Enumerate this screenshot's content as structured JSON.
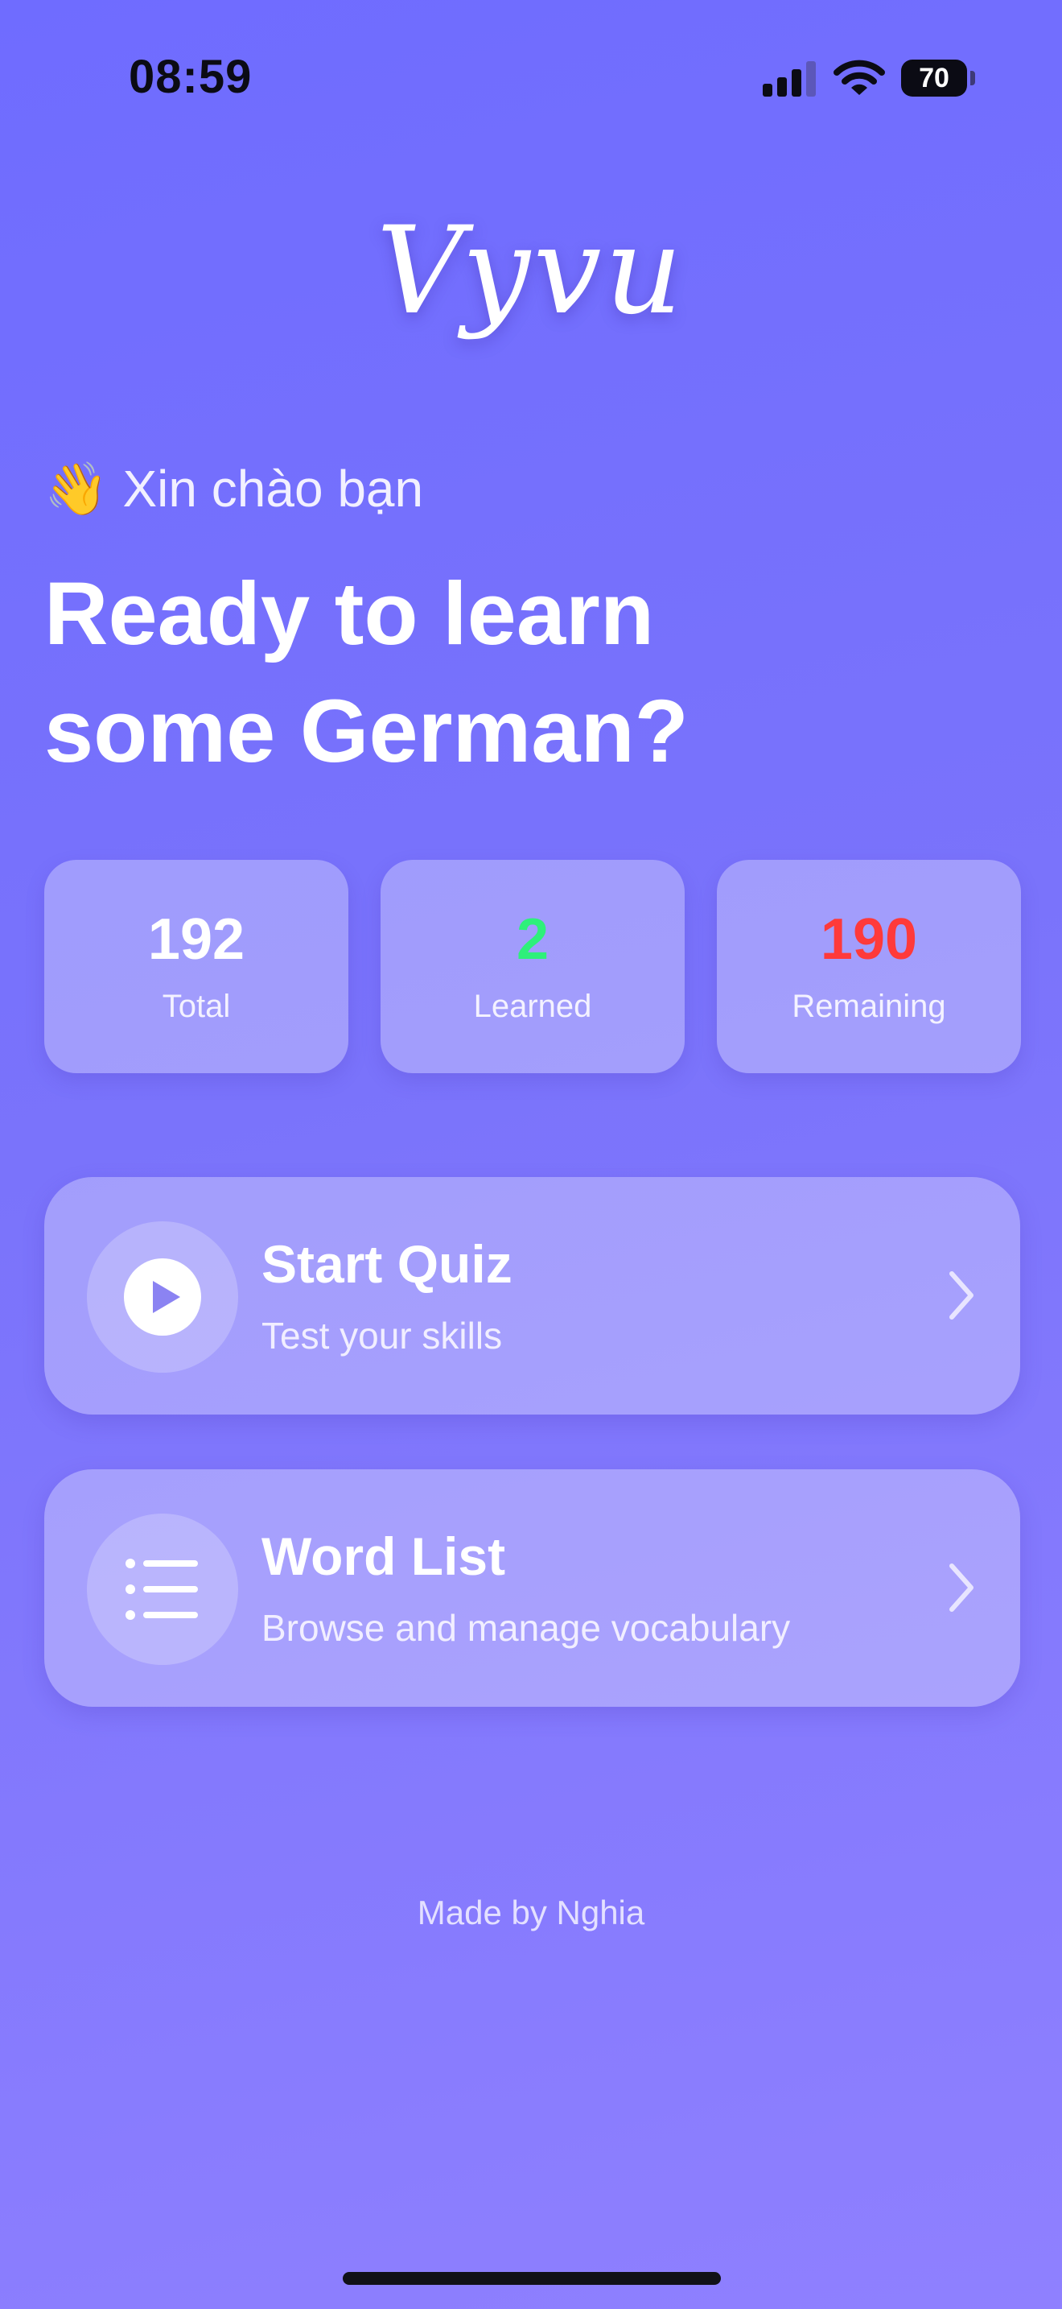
{
  "status_bar": {
    "time": "08:59",
    "battery": "70",
    "icons": [
      "cellular-signal-icon",
      "wifi-icon",
      "battery-icon"
    ]
  },
  "app": {
    "logo": "Vyvu"
  },
  "greeting": {
    "emoji": "👋",
    "text": "Xin chào bạn"
  },
  "headline": {
    "line1": "Ready to learn",
    "line2": "some German?"
  },
  "stats": [
    {
      "value": "192",
      "label": "Total",
      "color": "#ffffff"
    },
    {
      "value": "2",
      "label": "Learned",
      "color": "#2ef07a"
    },
    {
      "value": "190",
      "label": "Remaining",
      "color": "#ff3a3a"
    }
  ],
  "actions": [
    {
      "title": "Start Quiz",
      "subtitle": "Test your skills",
      "icon": "play-icon"
    },
    {
      "title": "Word List",
      "subtitle": "Browse and manage vocabulary",
      "icon": "list-icon"
    }
  ],
  "footer": {
    "text": "Made by Nghia"
  }
}
